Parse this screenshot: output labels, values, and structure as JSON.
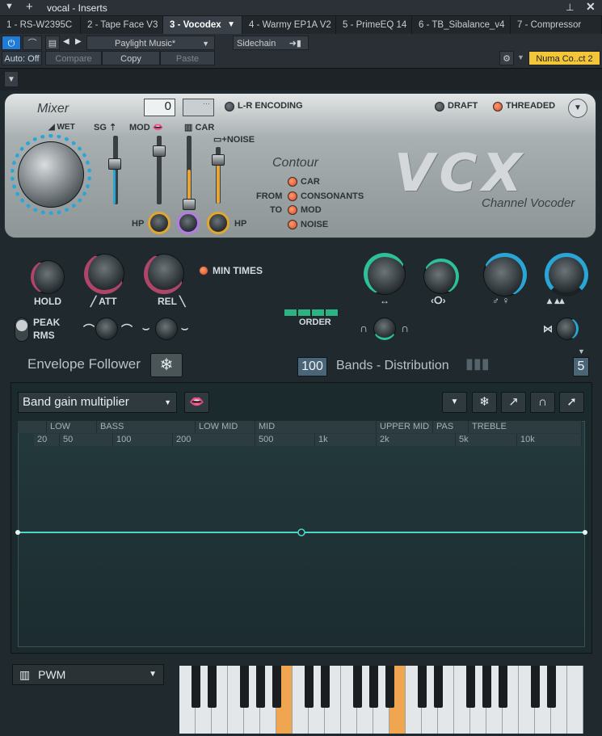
{
  "window": {
    "title": "vocal - Inserts"
  },
  "tabs": [
    {
      "label": "1 - RS-W2395C"
    },
    {
      "label": "2 - Tape Face V3"
    },
    {
      "label": "3 - Vocodex"
    },
    {
      "label": "4 - Warmy EP1A V2"
    },
    {
      "label": "5 - PrimeEQ 14"
    },
    {
      "label": "6 - TB_Sibalance_v4"
    },
    {
      "label": "7 - Compressor"
    }
  ],
  "toolbar": {
    "preset": "Paylight Music*",
    "sidechain": "Sidechain",
    "auto": "Auto: Off",
    "compare": "Compare",
    "copy": "Copy",
    "paste": "Paste",
    "device": "Numa Co..ct 2"
  },
  "mixer": {
    "title": "Mixer",
    "wet": "WET",
    "sg": "SG",
    "mod": "MOD",
    "car": "CAR",
    "noise": "+NOISE",
    "hp": "HP",
    "value": "0",
    "lr": "L-R ENCODING",
    "draft": "DRAFT",
    "threaded": "THREADED"
  },
  "contour": {
    "title": "Contour",
    "car": "CAR",
    "from": "FROM",
    "consonants": "CONSONANTS",
    "to": "TO",
    "mod": "MOD",
    "noise": "NOISE"
  },
  "brand": {
    "logo": "VCX",
    "subtitle": "Channel Vocoder"
  },
  "envelope": {
    "hold": "HOLD",
    "att": "ATT",
    "rel": "REL",
    "min_times": "MIN TIMES",
    "peak": "PEAK",
    "rms": "RMS",
    "title": "Envelope Follower"
  },
  "bands": {
    "order": "ORDER",
    "count": "100",
    "title": "Bands - Distribution",
    "value": "5"
  },
  "graph": {
    "mode": "Band gain multiplier",
    "regions": [
      "LOW BASS",
      "BASS",
      "LOW MID",
      "MID",
      "UPPER MID",
      "PAS",
      "TREBLE"
    ],
    "freqs": [
      "20",
      "50",
      "100",
      "200",
      "500",
      "1k",
      "2k",
      "5k",
      "10k"
    ]
  },
  "keyboard": {
    "wave": "PWM"
  }
}
